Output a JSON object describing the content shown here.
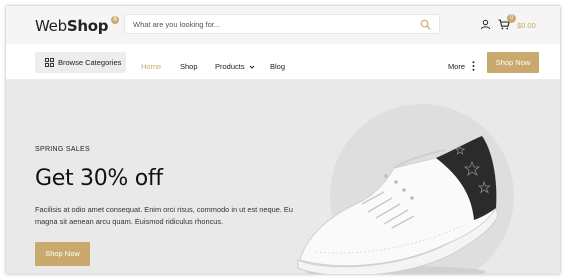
{
  "header": {
    "logo_prefix": "Web",
    "logo_bold": "Shop",
    "logo_badge": "8",
    "search_placeholder": "What are you looking for...",
    "cart_count": "0",
    "cart_total": "$0.00"
  },
  "nav": {
    "browse_label": "Browse Categories",
    "items": [
      {
        "label": "Home",
        "active": true
      },
      {
        "label": "Shop"
      },
      {
        "label": "Products"
      },
      {
        "label": "Blog"
      }
    ],
    "more_label": "More",
    "shop_now": "Shop Now"
  },
  "hero": {
    "kicker": "SPRING SALES",
    "headline": "Get 30% off",
    "description": "Facilisis at odio amet consequat. Enim orci risus, commodo in ut est neque. Eu magna sit aenean arcu quam. Euismod ridiculus rhoncus.",
    "button": "Shop Now"
  },
  "colors": {
    "accent": "#c9a96e",
    "hero_bg": "#e9e9e9",
    "topbar_bg": "#f5f5f5"
  },
  "icons": [
    "search-icon",
    "user-icon",
    "cart-icon",
    "grid-icon",
    "chevron-down-icon",
    "kebab-icon"
  ]
}
